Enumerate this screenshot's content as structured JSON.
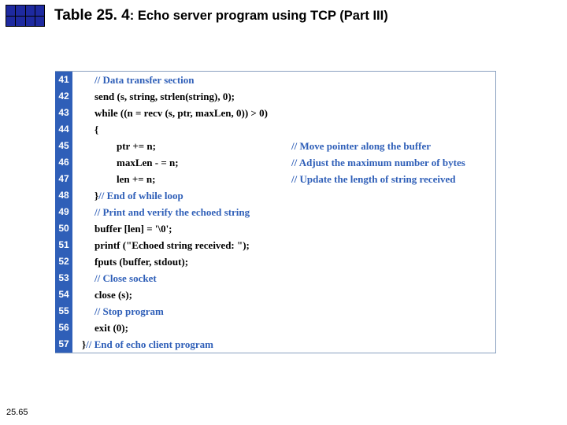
{
  "pageNumber": "25.65",
  "title": {
    "tbl": "Table 25. 4",
    "rest": ": Echo server program using TCP (Part III)"
  },
  "lineStart": 41,
  "lines": [
    {
      "n": 41,
      "i": 1,
      "t": "// Data transfer section",
      "klass": "cmt"
    },
    {
      "n": 42,
      "i": 1,
      "t": "send (s, string, strlen(string), 0);"
    },
    {
      "n": 43,
      "i": 1,
      "t": "while ((n = recv (s, ptr, maxLen, 0)) > 0)"
    },
    {
      "n": 44,
      "i": 1,
      "t": "{"
    },
    {
      "n": 45,
      "i": 2,
      "t": "ptr  += n;",
      "r": "// Move pointer along the buffer"
    },
    {
      "n": 46,
      "i": 2,
      "t": "maxLen  - = n;",
      "r": "// Adjust the maximum number of bytes"
    },
    {
      "n": 47,
      "i": 2,
      "t": "len  += n;",
      "r": "// Update the length of string received"
    },
    {
      "n": 48,
      "i": 1,
      "t": "}",
      "after": " // End of while loop"
    },
    {
      "n": 49,
      "i": 1,
      "t": "// Print and verify the echoed string",
      "klass": "cmt"
    },
    {
      "n": 50,
      "i": 1,
      "t": "buffer [len] = '\\0';"
    },
    {
      "n": 51,
      "i": 1,
      "t": "printf (\"Echoed string received: \");"
    },
    {
      "n": 52,
      "i": 1,
      "t": "fputs (buffer, stdout);"
    },
    {
      "n": 53,
      "i": 1,
      "t": "// Close socket",
      "klass": "cmt"
    },
    {
      "n": 54,
      "i": 1,
      "t": "close (s);"
    },
    {
      "n": 55,
      "i": 1,
      "t": "// Stop program",
      "klass": "cmt"
    },
    {
      "n": 56,
      "i": 1,
      "t": "exit (0);"
    },
    {
      "n": 57,
      "i": 0,
      "t": "}",
      "after": " // End of echo client program"
    }
  ]
}
